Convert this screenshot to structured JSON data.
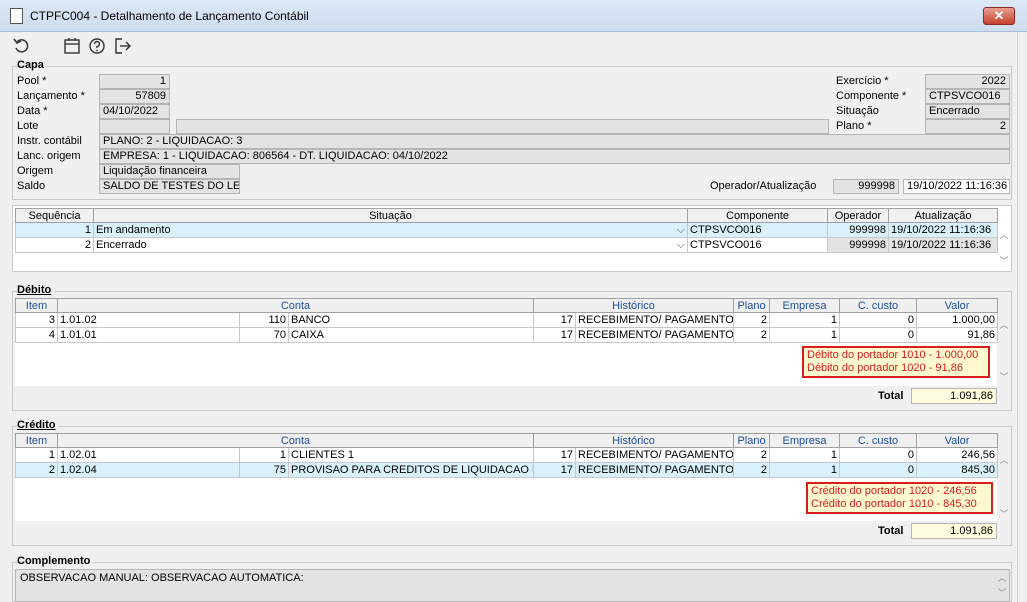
{
  "window": {
    "title": "CTPFC004 - Detalhamento de Lançamento Contábil",
    "close_glyph": "✕"
  },
  "toolbar": {
    "icons": [
      "undo-icon",
      "calendar-icon",
      "help-icon",
      "exit-icon"
    ]
  },
  "capa": {
    "title": "Capa",
    "pool_label": "Pool *",
    "pool_value": "1",
    "lancamento_label": "Lançamento *",
    "lancamento_value": "57809",
    "data_label": "Data *",
    "data_value": "04/10/2022",
    "lote_label": "Lote",
    "lote_value": "",
    "instr_label": "Instr. contábil",
    "instr_value": "PLANO: 2 - LIQUIDACAO: 3",
    "lanc_origem_label": "Lanc. origem",
    "lanc_origem_value": "EMPRESA: 1 - LIQUIDACAO: 806564 - DT. LIQUIDACAO: 04/10/2022",
    "origem_label": "Origem",
    "origem_value": "Liquidação financeira",
    "saldo_label": "Saldo",
    "saldo_value": "SALDO DE TESTES DO LEO",
    "exercicio_label": "Exercício *",
    "exercicio_value": "2022",
    "componente_label": "Componente *",
    "componente_value": "CTPSVCO016",
    "situacao_label": "Situação",
    "situacao_value": "Encerrado",
    "plano_label": "Plano *",
    "plano_value": "2",
    "operador_label": "Operador/Atualização",
    "operador_value": "999998",
    "atualizacao_value": "19/10/2022 11:16:36"
  },
  "status_grid": {
    "headers": [
      "Sequência",
      "Situação",
      "Componente",
      "Operador",
      "Atualização"
    ],
    "rows": [
      {
        "seq": "1",
        "situacao": "Em andamento",
        "componente": "CTPSVCO016",
        "operador": "999998",
        "atualizacao": "19/10/2022 11:16:36"
      },
      {
        "seq": "2",
        "situacao": "Encerrado",
        "componente": "CTPSVCO016",
        "operador": "999998",
        "atualizacao": "19/10/2022 11:16:36"
      }
    ]
  },
  "debito": {
    "title": "Débito",
    "headers": [
      "Item",
      "Conta",
      "Histórico",
      "Plano",
      "Empresa",
      "C. custo",
      "Valor"
    ],
    "rows": [
      {
        "item": "3",
        "conta": "1.01.02",
        "conta_id": "110",
        "conta_nome": "BANCO",
        "hist_id": "17",
        "hist": "RECEBIMENTO/ PAGAMENTO",
        "plano": "2",
        "empresa": "1",
        "ccusto": "0",
        "valor": "1.000,00"
      },
      {
        "item": "4",
        "conta": "1.01.01",
        "conta_id": "70",
        "conta_nome": "CAIXA",
        "hist_id": "17",
        "hist": "RECEBIMENTO/ PAGAMENTO",
        "plano": "2",
        "empresa": "1",
        "ccusto": "0",
        "valor": "91,86"
      }
    ],
    "note": [
      "Débito do portador 1010 - 1.000,00",
      "Débito do portador 1020 - 91,86"
    ],
    "total_label": "Total",
    "total_value": "1.091,86"
  },
  "credito": {
    "title": "Crédito",
    "headers": [
      "Item",
      "Conta",
      "Histórico",
      "Plano",
      "Empresa",
      "C. custo",
      "Valor"
    ],
    "rows": [
      {
        "item": "1",
        "conta": "1.02.01",
        "conta_id": "1",
        "conta_nome": "CLIENTES 1",
        "hist_id": "17",
        "hist": "RECEBIMENTO/ PAGAMENTO",
        "plano": "2",
        "empresa": "1",
        "ccusto": "0",
        "valor": "246,56"
      },
      {
        "item": "2",
        "conta": "1.02.04",
        "conta_id": "75",
        "conta_nome": "PROVISAO PARA CREDITOS DE LIQUIDACAO DUVIDOSA",
        "hist_id": "17",
        "hist": "RECEBIMENTO/ PAGAMENTO",
        "plano": "2",
        "empresa": "1",
        "ccusto": "0",
        "valor": "845,30"
      }
    ],
    "note": [
      "Crédito do portador 1020 - 246,56",
      "Crédito do portador 1010 - 845,30"
    ],
    "total_label": "Total",
    "total_value": "1.091,86"
  },
  "complemento": {
    "title": "Complemento",
    "text": "OBSERVACAO MANUAL:  OBSERVACAO AUTOMATICA:"
  }
}
